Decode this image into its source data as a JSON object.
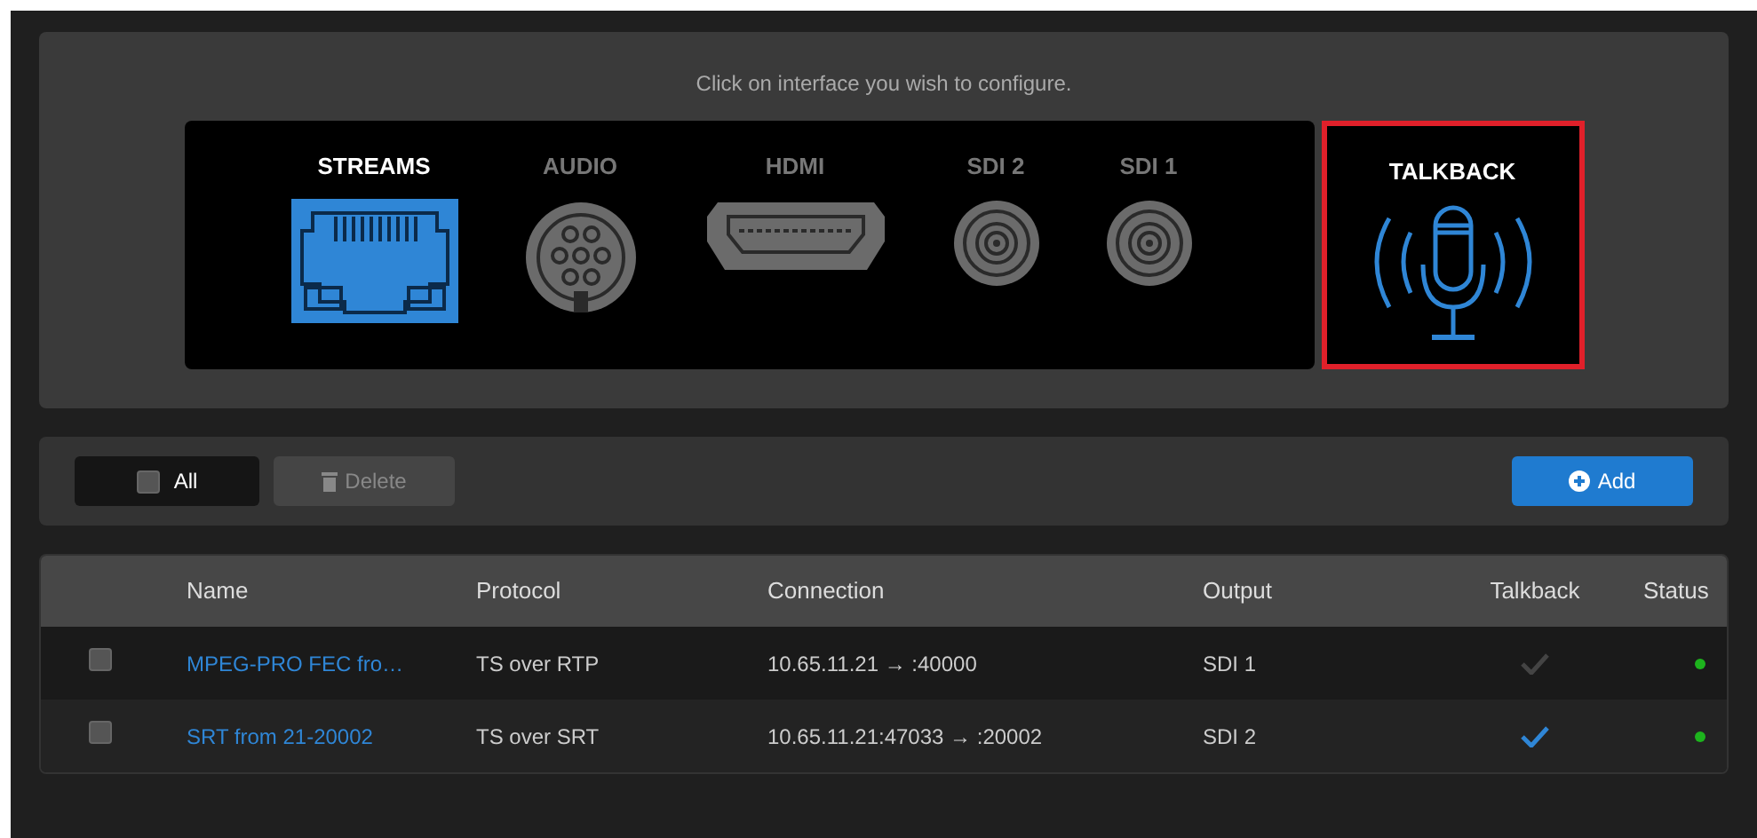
{
  "interface_panel": {
    "instruction": "Click on interface you wish to configure.",
    "interfaces": [
      {
        "kind": "rj45",
        "label": "STREAMS",
        "active": true,
        "highlighted": false
      },
      {
        "kind": "audio",
        "label": "AUDIO",
        "active": false,
        "highlighted": false
      },
      {
        "kind": "hdmi",
        "label": "HDMI",
        "active": false,
        "highlighted": false
      },
      {
        "kind": "bnc",
        "label": "SDI 2",
        "active": false,
        "highlighted": false
      },
      {
        "kind": "bnc",
        "label": "SDI 1",
        "active": false,
        "highlighted": false
      },
      {
        "kind": "mic",
        "label": "TALKBACK",
        "active": true,
        "highlighted": true
      }
    ]
  },
  "toolbar": {
    "select_all": {
      "label": "All",
      "checked": false
    },
    "delete_button": {
      "label": "Delete",
      "disabled": true
    },
    "add_button": {
      "label": "Add"
    }
  },
  "table": {
    "columns": [
      "Name",
      "Protocol",
      "Connection",
      "Output",
      "Talkback",
      "Status"
    ],
    "rows": [
      {
        "checked": false,
        "name": "MPEG-PRO FEC fro…",
        "protocol": "TS over RTP",
        "connection": "10.65.11.21 → :40000",
        "output": "SDI 1",
        "talkback": false,
        "color": "#1db31d"
      },
      {
        "checked": false,
        "name": "SRT from 21-20002",
        "protocol": "TS over SRT",
        "connection": "10.65.11.21:47033 → :20002",
        "output": "SDI 2",
        "talkback": true,
        "color": "#1db31d"
      }
    ]
  }
}
